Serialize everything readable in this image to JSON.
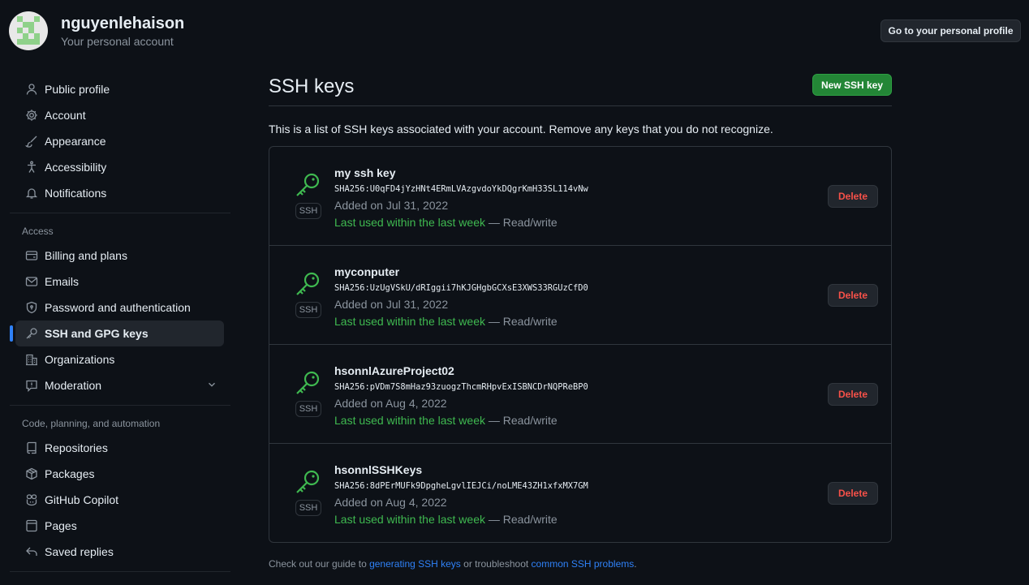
{
  "header": {
    "username": "nguyenlehaison",
    "subtitle": "Your personal account",
    "profile_button": "Go to your personal profile"
  },
  "sidebar": {
    "items_top": [
      {
        "label": "Public profile",
        "icon": "person-icon"
      },
      {
        "label": "Account",
        "icon": "gear-icon"
      },
      {
        "label": "Appearance",
        "icon": "paintbrush-icon"
      },
      {
        "label": "Accessibility",
        "icon": "accessibility-icon"
      },
      {
        "label": "Notifications",
        "icon": "bell-icon"
      }
    ],
    "access_label": "Access",
    "items_access": [
      {
        "label": "Billing and plans",
        "icon": "credit-card-icon"
      },
      {
        "label": "Emails",
        "icon": "mail-icon"
      },
      {
        "label": "Password and authentication",
        "icon": "shield-lock-icon"
      },
      {
        "label": "SSH and GPG keys",
        "icon": "key-icon",
        "active": true
      },
      {
        "label": "Organizations",
        "icon": "organization-icon"
      },
      {
        "label": "Moderation",
        "icon": "report-icon"
      }
    ],
    "code_label": "Code, planning, and automation",
    "items_code": [
      {
        "label": "Repositories",
        "icon": "repo-icon"
      },
      {
        "label": "Packages",
        "icon": "package-icon"
      },
      {
        "label": "GitHub Copilot",
        "icon": "copilot-icon"
      },
      {
        "label": "Pages",
        "icon": "browser-icon"
      },
      {
        "label": "Saved replies",
        "icon": "reply-icon"
      }
    ]
  },
  "main": {
    "title": "SSH keys",
    "new_button": "New SSH key",
    "intro": "This is a list of SSH keys associated with your account. Remove any keys that you do not recognize.",
    "ssh_badge": "SSH",
    "delete_label": "Delete",
    "keys": [
      {
        "title": "my ssh key",
        "fingerprint": "SHA256:U0qFD4jYzHNt4ERmLVAzgvdoYkDQgrKmH33SL114vNw",
        "added": "Added on Jul 31, 2022",
        "last_used": "Last used within the last week",
        "access": " — Read/write"
      },
      {
        "title": "myconputer",
        "fingerprint": "SHA256:UzUgVSkU/dRIggii7hKJGHgbGCXsE3XWS33RGUzCfD0",
        "added": "Added on Jul 31, 2022",
        "last_used": "Last used within the last week",
        "access": " — Read/write"
      },
      {
        "title": "hsonnlAzureProject02",
        "fingerprint": "SHA256:pVDm7S8mHaz93zuogzThcmRHpvExISBNCDrNQPReBP0",
        "added": "Added on Aug 4, 2022",
        "last_used": "Last used within the last week",
        "access": " — Read/write"
      },
      {
        "title": "hsonnlSSHKeys",
        "fingerprint": "SHA256:8dPErMUFk9DpgheLgvlIEJCi/noLME43ZH1xfxMX7GM",
        "added": "Added on Aug 4, 2022",
        "last_used": "Last used within the last week",
        "access": " — Read/write"
      }
    ],
    "footer": {
      "prefix": "Check out our guide to ",
      "link1": "generating SSH keys",
      "middle": " or troubleshoot ",
      "link2": "common SSH problems",
      "suffix": "."
    }
  },
  "colors": {
    "background": "#0d1117",
    "primary_button": "#238636",
    "danger": "#f85149",
    "success": "#3fb950",
    "accent": "#2f81f7"
  }
}
